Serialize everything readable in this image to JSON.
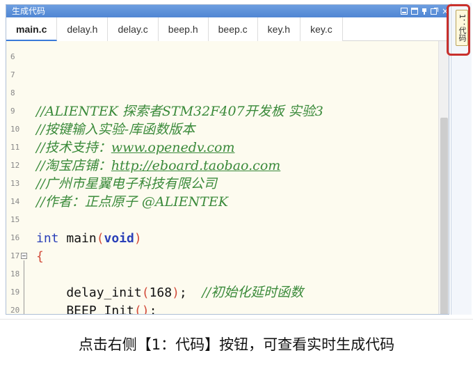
{
  "window": {
    "title": "生成代码",
    "buttons": [
      "restore-icon",
      "maximize-icon",
      "pin-icon",
      "float-icon",
      "close-icon"
    ],
    "close_label": "×"
  },
  "tabs": [
    {
      "label": "main.c",
      "active": true
    },
    {
      "label": "delay.h",
      "active": false
    },
    {
      "label": "delay.c",
      "active": false
    },
    {
      "label": "beep.h",
      "active": false
    },
    {
      "label": "beep.c",
      "active": false
    },
    {
      "label": "key.h",
      "active": false
    },
    {
      "label": "key.c",
      "active": false
    }
  ],
  "editor": {
    "line_numbers": [
      "6",
      "7",
      "8",
      "9",
      "10",
      "11",
      "12",
      "13",
      "14",
      "15",
      "16",
      "17",
      "18",
      "19",
      "20"
    ],
    "lines": {
      "l9": "//ALIENTEK 探索者STM32F407开发板 实验3",
      "l10": "//按键输入实验-库函数版本",
      "l11_prefix": "//技术支持：",
      "l11_link": "www.openedv.com",
      "l12_prefix": "//淘宝店铺：",
      "l12_link": "http://eboard.taobao.com",
      "l13": "//广州市星翼电子科技有限公司",
      "l14": "//作者：正点原子 @ALIENTEK",
      "l16_kw": "int",
      "l16_name": " main",
      "l16_open": "(",
      "l16_kw2": "void",
      "l16_close": ")",
      "l17": "{",
      "l19_call": "    delay_init",
      "l19_open": "(",
      "l19_num": "168",
      "l19_close": ")",
      "l19_semi": ";  ",
      "l19_comment": "//初始化延时函数",
      "l20_call": "    BEEP_Init",
      "l20_parens": "()",
      "l20_semi": ";"
    }
  },
  "sidebar": {
    "tab_label": "1：代码"
  },
  "caption": "点击右侧【1：代码】按钮，可查看实时生成代码",
  "colors": {
    "comment": "#3a8a3a",
    "keyword": "#2a3fb8",
    "paren": "#d24b3a",
    "highlight": "#c9302c",
    "titlebar": "#4f86d3"
  }
}
